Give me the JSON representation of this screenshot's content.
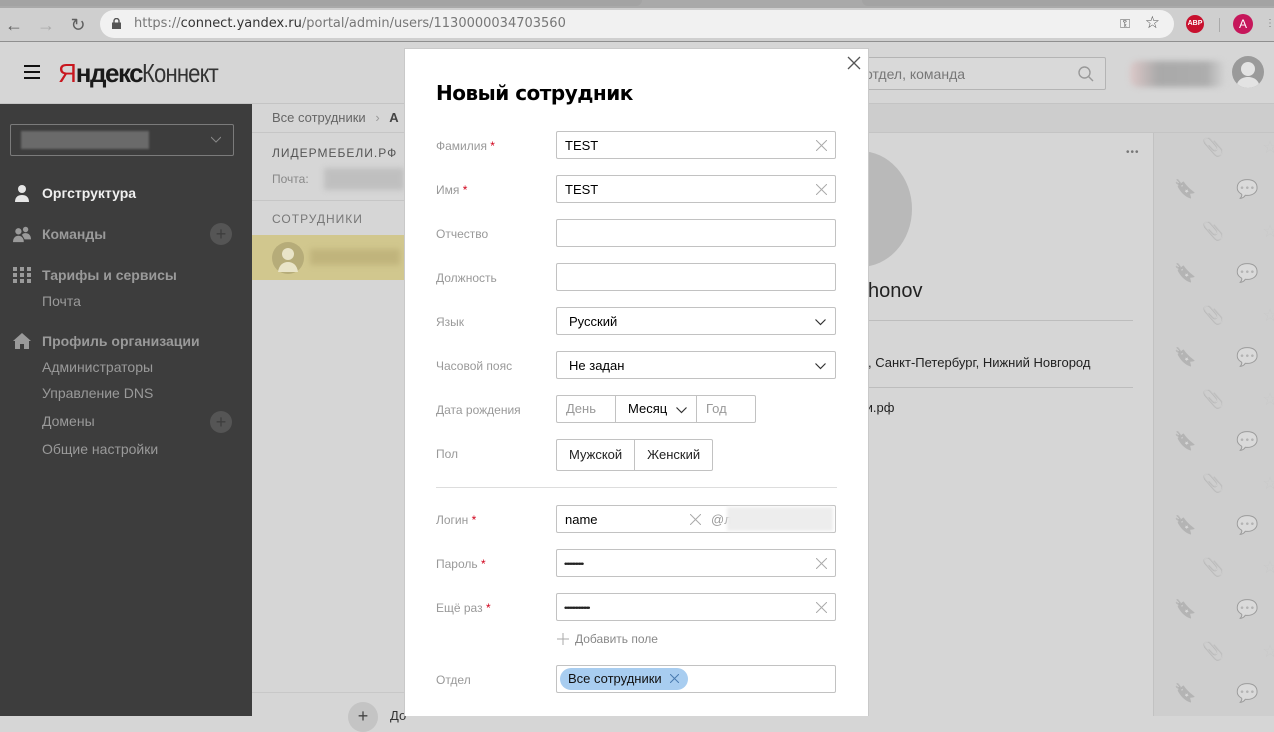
{
  "browser": {
    "url_prefix": "https://",
    "url_host": "connect.yandex.ru",
    "url_path": "/portal/admin/users/1130000034703560",
    "back_icon": "arrow-left-icon",
    "forward_icon": "arrow-right-icon",
    "reload_icon": "reload-icon",
    "abp_label": "ABP",
    "profile_initial": "A"
  },
  "header": {
    "logo_first": "Я",
    "logo_rest": "ндекс",
    "logo_product": " Коннект",
    "search_placeholder": "отдел, команда"
  },
  "sidebar": {
    "items": [
      {
        "label": "Оргструктура",
        "icon": "person-icon",
        "active": true
      },
      {
        "label": "Команды",
        "icon": "people-icon"
      },
      {
        "label": "Тарифы и сервисы",
        "icon": "grid-icon"
      },
      {
        "label": "Профиль организации",
        "icon": "home-icon"
      }
    ],
    "services_sub": [
      "Почта"
    ],
    "profile_sub": [
      "Администраторы",
      "Управление DNS",
      "Домены",
      "Общие настройки"
    ]
  },
  "midpanel": {
    "breadcrumb_root": "Все сотрудники",
    "breadcrumb_sep": "›",
    "breadcrumb_next": "А",
    "org_name": "ЛИДЕРМЕБЕЛИ.РФ",
    "mail_label": "Почта:",
    "staff_heading": "СОТРУДНИКИ",
    "add_label": "До"
  },
  "profile": {
    "name_partial": "khonov",
    "cities_partial": ", Санкт-Петербург, Нижний Новгород",
    "domain_partial": "ли.рф",
    "more_icon": "•••"
  },
  "modal": {
    "title": "Новый сотрудник",
    "required_mark": "*",
    "fields": {
      "last_name": {
        "label": "Фамилия",
        "value": "TEST"
      },
      "first_name": {
        "label": "Имя",
        "value": "TEST"
      },
      "middle_name": {
        "label": "Отчество",
        "value": ""
      },
      "position": {
        "label": "Должность",
        "value": ""
      },
      "language": {
        "label": "Язык",
        "value": "Русский"
      },
      "timezone": {
        "label": "Часовой пояс",
        "value": "Не задан"
      },
      "birthdate": {
        "label": "Дата рождения",
        "day_placeholder": "День",
        "month_value": "Месяц",
        "year_placeholder": "Год"
      },
      "gender": {
        "label": "Пол",
        "options": [
          "Мужской",
          "Женский"
        ]
      },
      "login": {
        "label": "Логин",
        "value": "name",
        "domain_prefix": "@л"
      },
      "password": {
        "label": "Пароль",
        "value": "••••••••••••"
      },
      "password_repeat": {
        "label": "Ещё раз",
        "value": "••••••••••••••••"
      },
      "department": {
        "label": "Отдел",
        "tag": "Все сотрудники"
      }
    },
    "add_field_label": "Добавить поле"
  }
}
